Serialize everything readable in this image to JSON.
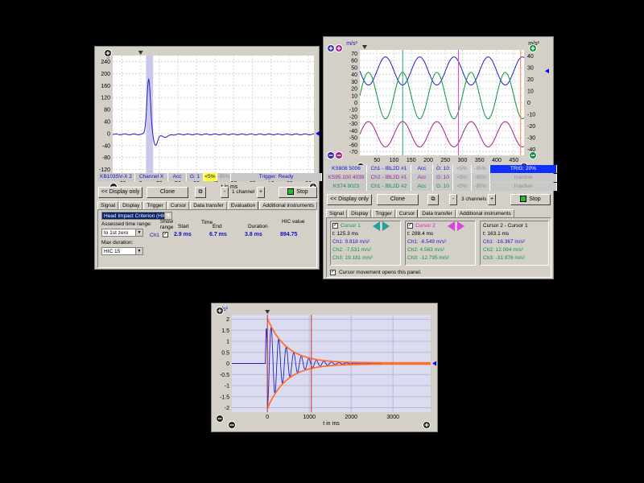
{
  "w1": {
    "y_unit": "g",
    "x_unit": "t in ms",
    "y_ticks": [
      "240",
      "200",
      "160",
      "120",
      "80",
      "40",
      "0",
      "-40",
      "-80",
      "-120"
    ],
    "x_ticks": [
      "-10",
      "0",
      "10",
      "20",
      "30",
      "40",
      "50",
      "60",
      "70",
      "80",
      "90"
    ],
    "channel_row": [
      "KB103SV-X 2",
      "Channel X",
      "Acc",
      "G: 1",
      "<5%",
      "-95%",
      "Trigger: Ready"
    ],
    "buttons": {
      "display_only": "<< Display only",
      "clone": "Clone",
      "minus": "-",
      "channels": "1 channel",
      "plus": "+",
      "stop": "Stop"
    },
    "tabs": [
      "Signal",
      "Display",
      "Trigger",
      "Cursor",
      "Data transfer",
      "Evaluation",
      "Additional instruments"
    ],
    "eval": {
      "method": "Head Impact Criterion (HIC)",
      "assessed_label": "Assessed time range:",
      "assessed_value": "to 1st zero",
      "max_duration_label": "Max duration:",
      "max_duration_value": "HIC 15",
      "show_range_label": "Show range",
      "ch_label": "Ch1",
      "start_label": "Start",
      "time_label": "Time",
      "end_label": "End",
      "duration_label": "Duration",
      "hic_label": "HIC value",
      "start_value": "2.9 ms",
      "end_value": "6.7 ms",
      "duration_value": "3.8 ms",
      "hic_value": "894.75"
    }
  },
  "w2": {
    "y_unit_left": "m/s²",
    "y_unit_right": "m/s²",
    "x_unit": "t in ms",
    "y_ticks_left": [
      "70",
      "60",
      "50",
      "40",
      "30",
      "20",
      "10",
      "0",
      "-10",
      "-20",
      "-30",
      "-40",
      "-50",
      "-60",
      "-70"
    ],
    "y_ticks_right": [
      "40",
      "30",
      "20",
      "10",
      "0",
      "-10",
      "-20",
      "-30",
      "-40"
    ],
    "x_ticks": [
      "50",
      "100",
      "150",
      "200",
      "250",
      "300",
      "350",
      "400",
      "450"
    ],
    "channel_rows": [
      [
        "KS808 5006",
        "Ch1 - IBL2D #1",
        "Acc",
        "G: 10",
        "<5%",
        "-95%",
        "TRIG: 20%"
      ],
      [
        "KS95.100 4039",
        "Ch2 - IBL2D #1",
        "Acc",
        "G: 10",
        "<5%",
        "-95%",
        "Inactive"
      ],
      [
        "KS74 9023",
        "Ch1 - IBL2D #2",
        "Acc",
        "G: 10",
        "<5%",
        "-95%",
        "Inactive"
      ]
    ],
    "buttons": {
      "display_only": "<< Display only",
      "clone": "Clone",
      "minus": "-",
      "channels": "3 channels",
      "plus": "+",
      "stop": "Stop"
    },
    "tabs": [
      "Signal",
      "Display",
      "Trigger",
      "Cursor",
      "Data transfer",
      "Additional instruments"
    ],
    "cursor1": {
      "title": "Cursor 1",
      "t": "t: 125.3 ms",
      "ch1": "Ch1: 9.818 m/s²",
      "ch2": "Ch2: -7.531 m/s²",
      "ch3": "Ch3: 19.181 m/s²"
    },
    "cursor2": {
      "title": "Cursor 2",
      "t": "t: 288.4 ms",
      "ch1": "Ch1: -6.549 m/s²",
      "ch2": "Ch2: 4.563 m/s²",
      "ch3": "Ch3: -12.795 m/s²"
    },
    "diff": {
      "title": "Cursor 2 - Cursor 1",
      "t": "t: 163.1 ms",
      "ch1": "Ch1: -16.367 m/s²",
      "ch2": "Ch2: 12.094 m/s²",
      "ch3": "Ch3: -31.976 m/s²"
    },
    "cursor_note": "Cursor movement opens this panel."
  },
  "w3": {
    "y_unit": "m/s²",
    "x_unit": "t in ms",
    "y_ticks": [
      "2",
      "1.5",
      "1",
      "0.5",
      "0",
      "-0.5",
      "-1",
      "-1.5",
      "-2"
    ],
    "x_ticks": [
      "0",
      "1000",
      "2000",
      "3000"
    ]
  },
  "colors": {
    "ch1": "#2020c0",
    "ch2": "#109040",
    "ch3": "#a02090",
    "envelope": "#ff7030",
    "cursor_red": "#d03030",
    "accent_blue": "#0000ff"
  }
}
